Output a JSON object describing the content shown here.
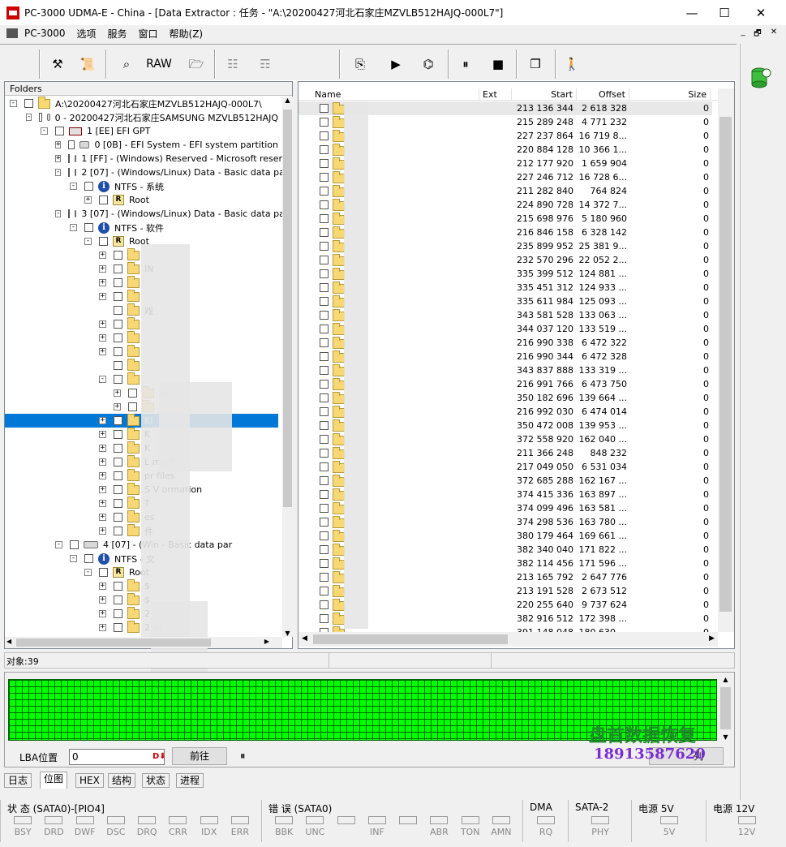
{
  "window": {
    "title": "PC-3000 UDMA-E - China - [Data Extractor : 任务 - \"A:\\20200427河北石家庄MZVLB512HAJQ-000L7\"]",
    "controls": {
      "min": "—",
      "max": "☐",
      "close": "✕"
    }
  },
  "menu": {
    "items": [
      "PC-3000",
      "选项",
      "服务",
      "窗口",
      "帮助(Z)"
    ],
    "mdi": {
      "min": "_",
      "restore": "🗗",
      "close": "✕"
    }
  },
  "toolbar": {
    "raw_label": "RAW"
  },
  "folders": {
    "header": "Folders",
    "nodes": [
      {
        "label": "A:\\20200427河北石家庄MZVLB512HAJQ-000L7\\",
        "icon": "project"
      },
      {
        "label": "0 - 20200427河北石家庄SAMSUNG MZVLB512HAJQ",
        "icon": "drive"
      },
      {
        "label": "1 [EE] EFI GPT",
        "icon": "gpt"
      },
      {
        "label": "0 [0B] - EFI System - EFI system partition",
        "icon": "drive"
      },
      {
        "label": "1 [FF] - (Windows) Reserved - Microsoft reserv",
        "icon": "drive"
      },
      {
        "label": "2 [07] - (Windows/Linux) Data - Basic data par",
        "icon": "drive"
      },
      {
        "label": "NTFS - 系统",
        "icon": "info"
      },
      {
        "label": "Root",
        "icon": "root"
      },
      {
        "label": "3 [07] - (Windows/Linux) Data - Basic data par",
        "icon": "drive"
      },
      {
        "label": "NTFS - 软件",
        "icon": "info"
      },
      {
        "label": "Root",
        "icon": "root"
      },
      {
        "label": "",
        "icon": "folder"
      },
      {
        "label": "IN",
        "icon": "folder"
      },
      {
        "label": "",
        "icon": "folder"
      },
      {
        "label": "",
        "icon": "folder"
      },
      {
        "label": "戏",
        "icon": "folder"
      },
      {
        "label": "",
        "icon": "folder"
      },
      {
        "label": "",
        "icon": "folder"
      },
      {
        "label": "",
        "icon": "folder"
      },
      {
        "label": "",
        "icon": "folder"
      },
      {
        "label": "",
        "icon": "folder"
      },
      {
        "label": "版",
        "icon": "folder"
      },
      {
        "label": "",
        "icon": "folder"
      },
      {
        "label": "Kl",
        "icon": "folder"
      },
      {
        "label": "K",
        "icon": "folder"
      },
      {
        "label": "K",
        "icon": "folder"
      },
      {
        "label": "L        meM",
        "icon": "folder"
      },
      {
        "label": "pr      files",
        "icon": "folder"
      },
      {
        "label": "S     V      ormation",
        "icon": "folder"
      },
      {
        "label": "T",
        "icon": "folder"
      },
      {
        "label": "        es",
        "icon": "folder"
      },
      {
        "label": "              件",
        "icon": "folder"
      },
      {
        "label": "4 [07] - (Win          - Basic data par",
        "icon": "drive"
      },
      {
        "label": "NTFS - 文",
        "icon": "info"
      },
      {
        "label": "Root",
        "icon": "root"
      },
      {
        "label": "$",
        "icon": "folder"
      },
      {
        "label": "$",
        "icon": "folder"
      },
      {
        "label": "2",
        "icon": "folder"
      },
      {
        "label": "2       44",
        "icon": "folder"
      }
    ]
  },
  "files": {
    "columns": {
      "name": "Name",
      "ext": "Ext",
      "start": "Start",
      "offset": "Offset",
      "size": "Size"
    },
    "rows": [
      {
        "start": "213 136 344",
        "offset": "2 618 328",
        "size": "0"
      },
      {
        "start": "215 289 248",
        "offset": "4 771 232",
        "size": "0"
      },
      {
        "start": "227 237 864",
        "offset": "16 719 8...",
        "size": "0"
      },
      {
        "start": "220 884 128",
        "offset": "10 366 1...",
        "size": "0"
      },
      {
        "start": "212 177 920",
        "offset": "1 659 904",
        "size": "0"
      },
      {
        "start": "227 246 712",
        "offset": "16 728 6...",
        "size": "0"
      },
      {
        "start": "211 282 840",
        "offset": "764 824",
        "size": "0"
      },
      {
        "start": "224 890 728",
        "offset": "14 372 7...",
        "size": "0"
      },
      {
        "start": "215 698 976",
        "offset": "5 180 960",
        "size": "0"
      },
      {
        "start": "216 846 158",
        "offset": "6 328 142",
        "size": "0"
      },
      {
        "start": "235 899 952",
        "offset": "25 381 9...",
        "size": "0"
      },
      {
        "start": "232 570 296",
        "offset": "22 052 2...",
        "size": "0"
      },
      {
        "start": "335 399 512",
        "offset": "124 881 ...",
        "size": "0"
      },
      {
        "start": "335 451 312",
        "offset": "124 933 ...",
        "size": "0"
      },
      {
        "start": "335 611 984",
        "offset": "125 093 ...",
        "size": "0"
      },
      {
        "start": "343 581 528",
        "offset": "133 063 ...",
        "size": "0"
      },
      {
        "start": "344 037 120",
        "offset": "133 519 ...",
        "size": "0"
      },
      {
        "start": "216 990 338",
        "offset": "6 472 322",
        "size": "0"
      },
      {
        "start": "216 990 344",
        "offset": "6 472 328",
        "size": "0"
      },
      {
        "start": "343 837 888",
        "offset": "133 319 ...",
        "size": "0"
      },
      {
        "start": "216 991 766",
        "offset": "6 473 750",
        "size": "0"
      },
      {
        "start": "350 182 696",
        "offset": "139 664 ...",
        "size": "0"
      },
      {
        "start": "216 992 030",
        "offset": "6 474 014",
        "size": "0"
      },
      {
        "start": "350 472 008",
        "offset": "139 953 ...",
        "size": "0"
      },
      {
        "start": "372 558 920",
        "offset": "162 040 ...",
        "size": "0"
      },
      {
        "start": "211 366 248",
        "offset": "848 232",
        "size": "0"
      },
      {
        "start": "217 049 050",
        "offset": "6 531 034",
        "size": "0"
      },
      {
        "start": "372 685 288",
        "offset": "162 167 ...",
        "size": "0"
      },
      {
        "start": "374 415 336",
        "offset": "163 897 ...",
        "size": "0"
      },
      {
        "start": "374 099 496",
        "offset": "163 581 ...",
        "size": "0"
      },
      {
        "start": "374 298 536",
        "offset": "163 780 ...",
        "size": "0"
      },
      {
        "start": "380 179 464",
        "offset": "169 661 ...",
        "size": "0"
      },
      {
        "start": "382 340 040",
        "offset": "171 822 ...",
        "size": "0"
      },
      {
        "start": "382 114 456",
        "offset": "171 596 ...",
        "size": "0"
      },
      {
        "start": "213 165 792",
        "offset": "2 647 776",
        "size": "0"
      },
      {
        "start": "213 191 528",
        "offset": "2 673 512",
        "size": "0"
      },
      {
        "start": "220 255 640",
        "offset": "9 737 624",
        "size": "0"
      },
      {
        "start": "382 916 512",
        "offset": "172 398 ...",
        "size": "0"
      },
      {
        "start": "391 148 048",
        "offset": "180 630 ...",
        "size": "0"
      }
    ]
  },
  "status": {
    "objects": "对象:39"
  },
  "sector": {
    "lba_label": "LBA位置",
    "lba_value": "0",
    "goto_button": "前往",
    "pause_glyph": "⏸",
    "right_button": "列",
    "watermark_title": "盘首数据恢复",
    "watermark_phone": "18913587620"
  },
  "tabs": [
    "日志",
    "位图",
    "HEX",
    "结构",
    "状态",
    "进程"
  ],
  "bottom": {
    "state": {
      "title": "状 态 (SATA0)-[PIO4]",
      "leds": [
        "BSY",
        "DRD",
        "DWF",
        "DSC",
        "DRQ",
        "CRR",
        "IDX",
        "ERR"
      ]
    },
    "error": {
      "title": "错 误 (SATA0)",
      "leds": [
        "BBK",
        "UNC",
        "",
        "INF",
        "",
        "ABR",
        "TON",
        "AMN"
      ]
    },
    "dma": {
      "title": "DMA",
      "leds": [
        "RQ"
      ]
    },
    "sata2": {
      "title": "SATA-2",
      "leds": [
        "PHY"
      ]
    },
    "p5": {
      "title": "电源 5V",
      "leds": [
        "5V"
      ]
    },
    "p12": {
      "title": "电源 12V",
      "leds": [
        "12V"
      ]
    }
  },
  "colors": {
    "selection": "#0078d7",
    "bitmap_green": "#00ff00",
    "watermark_green": "#1f8a2a",
    "watermark_purple": "#7a2bd6"
  }
}
